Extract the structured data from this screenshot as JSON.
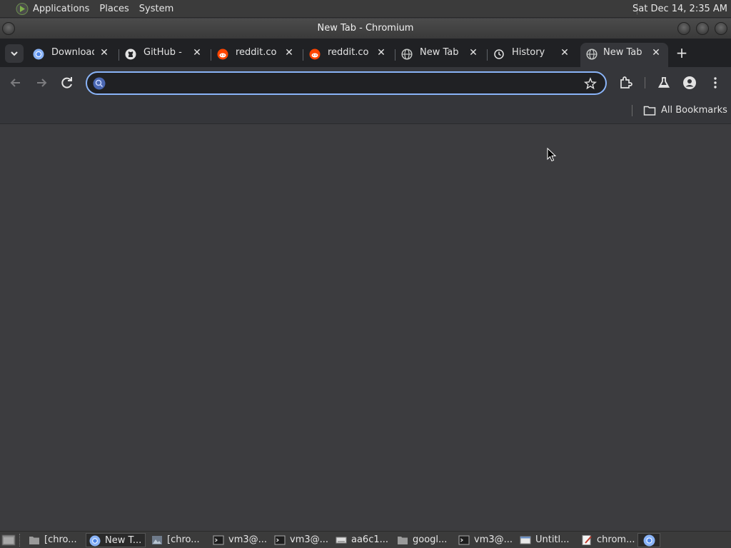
{
  "panel": {
    "menus": [
      "Applications",
      "Places",
      "System"
    ],
    "clock": "Sat Dec 14,  2:35 AM"
  },
  "window": {
    "title": "New Tab - Chromium"
  },
  "tabs": [
    {
      "label": "Downloads",
      "icon": "chrome-icon"
    },
    {
      "label": "GitHub - g",
      "icon": "github-icon"
    },
    {
      "label": "reddit.com",
      "icon": "reddit-icon"
    },
    {
      "label": "reddit.com",
      "icon": "reddit-icon"
    },
    {
      "label": "New Tab",
      "icon": "globe-icon"
    },
    {
      "label": "History",
      "icon": "history-icon"
    },
    {
      "label": "New Tab",
      "icon": "globe-icon",
      "active": true
    }
  ],
  "omnibox": {
    "value": "",
    "placeholder": ""
  },
  "bookmarks": {
    "all_label": "All Bookmarks"
  },
  "taskbar": [
    {
      "label": "[chro...",
      "icon": "folder-icon"
    },
    {
      "label": "New T...",
      "icon": "chromium-icon",
      "active": true
    },
    {
      "label": "[chro...",
      "icon": "image-icon"
    },
    {
      "label": "vm3@...",
      "icon": "terminal-icon"
    },
    {
      "label": "vm3@...",
      "icon": "terminal-icon"
    },
    {
      "label": "aa6c1...",
      "icon": "keyboard-icon"
    },
    {
      "label": "googl...",
      "icon": "folder-icon"
    },
    {
      "label": "vm3@...",
      "icon": "terminal-icon"
    },
    {
      "label": "Untitl...",
      "icon": "window-icon"
    },
    {
      "label": "chrom...",
      "icon": "text-editor-icon"
    }
  ],
  "colors": {
    "accent": "#8ab4f8",
    "tabstrip": "#202124",
    "toolbar": "#35363a",
    "content": "#3c3c3f"
  }
}
